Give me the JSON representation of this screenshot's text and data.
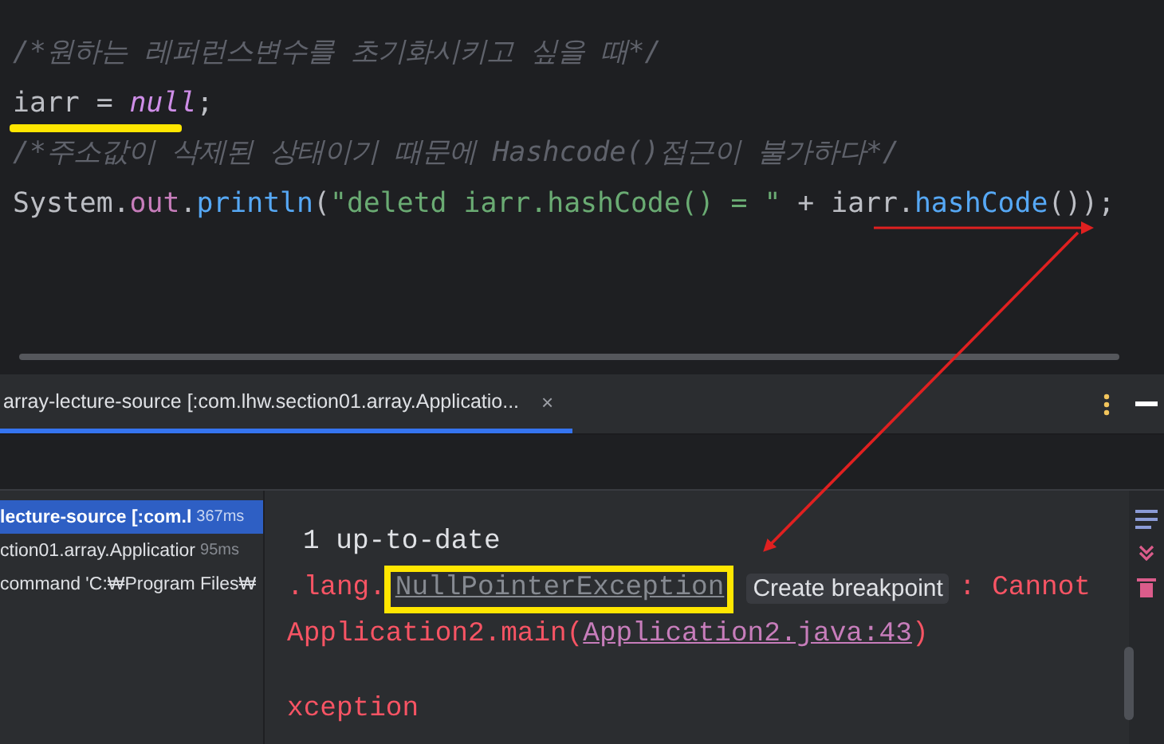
{
  "editor": {
    "lines": [
      {
        "tokens": [
          {
            "text": "/*원하는 레퍼런스변수를 초기화시키고 싶을 때*/",
            "kind": "comment"
          }
        ]
      },
      {
        "tokens": [
          {
            "text": "iarr = ",
            "kind": "plain"
          },
          {
            "text": "null",
            "kind": "keyword"
          },
          {
            "text": ";",
            "kind": "plain"
          }
        ]
      },
      {
        "tokens": [
          {
            "text": "/*주소값이 삭제된 상태이기 때문에 Hashcode()접근이 불가하다*/",
            "kind": "comment"
          }
        ]
      },
      {
        "tokens": [
          {
            "text": "System.",
            "kind": "plain"
          },
          {
            "text": "out",
            "kind": "field"
          },
          {
            "text": ".",
            "kind": "plain"
          },
          {
            "text": "println",
            "kind": "method"
          },
          {
            "text": "(",
            "kind": "plain"
          },
          {
            "text": "\"deletd iarr.hashCode() = \"",
            "kind": "string"
          },
          {
            "text": " + iarr.",
            "kind": "plain"
          },
          {
            "text": "hashCode",
            "kind": "method"
          },
          {
            "text": "());",
            "kind": "plain"
          }
        ]
      }
    ]
  },
  "run_panel": {
    "tab": {
      "label": "array-lecture-source [:com.lhw.section01.array.Applicatio...",
      "close": "×",
      "selected": true
    },
    "tree": [
      {
        "label": "lecture-source [:com.l",
        "time": "367ms",
        "selected": true
      },
      {
        "label": "ction01.array.Applicatior",
        "time": "95ms",
        "selected": false
      },
      {
        "label": "command 'C:₩Program Files₩",
        "selected": false
      }
    ],
    "console": {
      "lines": [
        {
          "segments": [
            {
              "text": "1 up-to-date",
              "kind": "plain"
            }
          ]
        },
        {
          "segments": [
            {
              "text": ".lang.",
              "kind": "error"
            },
            {
              "text": "NullPointerException",
              "kind": "class-link"
            },
            {
              "text": "Create breakpoint",
              "kind": "hint"
            },
            {
              "text": ": Cannot",
              "kind": "error"
            }
          ]
        },
        {
          "segments": [
            {
              "text": "Application2.main(",
              "kind": "error"
            },
            {
              "text": "Application2.java:43",
              "kind": "file-link"
            },
            {
              "text": ")",
              "kind": "error"
            }
          ]
        },
        {
          "segments": [
            {
              "text": "xception",
              "kind": "error"
            }
          ]
        }
      ]
    }
  }
}
